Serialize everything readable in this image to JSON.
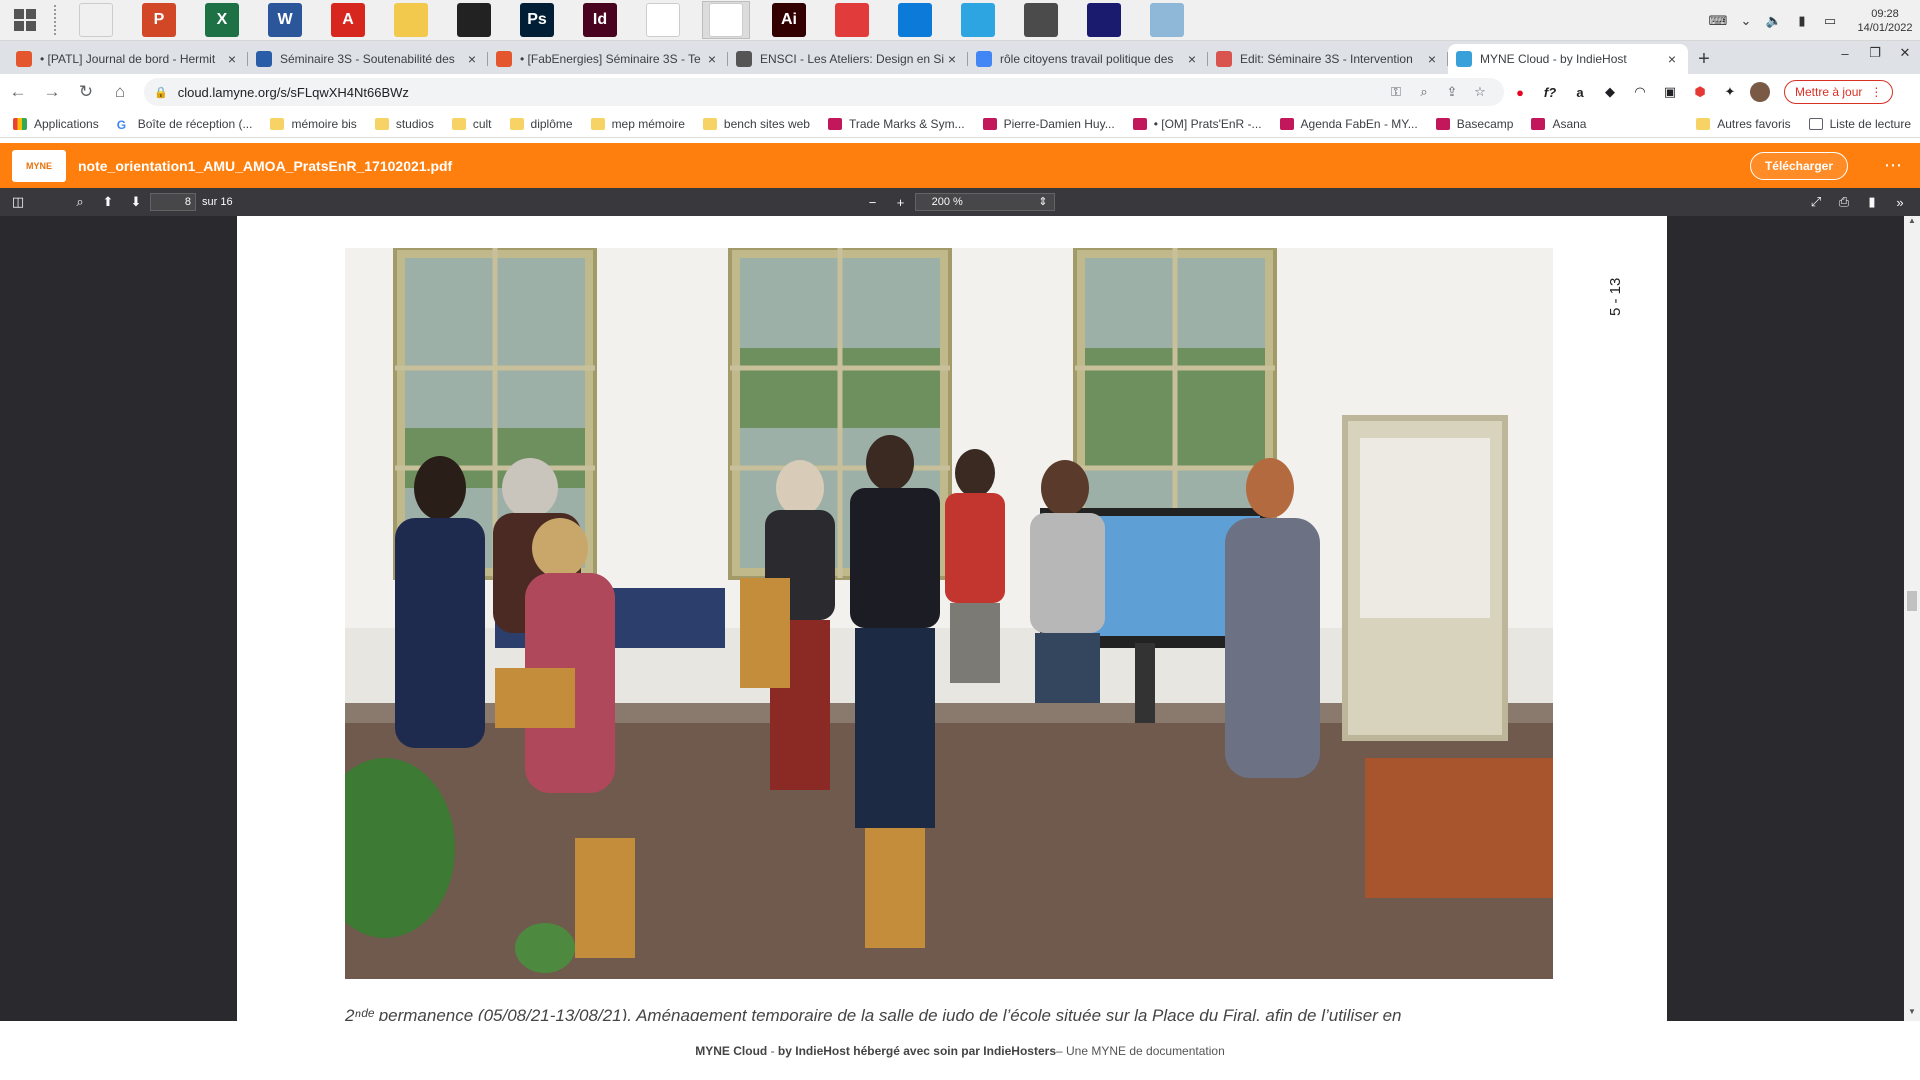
{
  "taskbar": {
    "apps": [
      {
        "icon": "file-explorer-icon",
        "label": "",
        "color": "#f0f0f0"
      },
      {
        "icon": "powerpoint-icon",
        "label": "P",
        "color": "#d24726"
      },
      {
        "icon": "excel-icon",
        "label": "X",
        "color": "#1e7145"
      },
      {
        "icon": "word-icon",
        "label": "W",
        "color": "#2b579a"
      },
      {
        "icon": "acrobat-icon",
        "label": "A",
        "color": "#d7261e"
      },
      {
        "icon": "folder-icon",
        "label": "",
        "color": "#f2c94c"
      },
      {
        "icon": "inkscape-icon",
        "label": "",
        "color": "#222222"
      },
      {
        "icon": "photoshop-icon",
        "label": "Ps",
        "color": "#001e36"
      },
      {
        "icon": "indesign-icon",
        "label": "Id",
        "color": "#49021f"
      },
      {
        "icon": "pdf-icon",
        "label": "",
        "color": "#ffffff"
      },
      {
        "icon": "chrome-icon",
        "label": "",
        "color": "#ffffff"
      },
      {
        "icon": "illustrator-icon",
        "label": "Ai",
        "color": "#330000"
      },
      {
        "icon": "chat-icon",
        "label": "",
        "color": "#e23b3b"
      },
      {
        "icon": "edge-icon",
        "label": "",
        "color": "#0c7ad8"
      },
      {
        "icon": "telegram-icon",
        "label": "",
        "color": "#2ca5e0"
      },
      {
        "icon": "sublime-icon",
        "label": "",
        "color": "#4b4b4b"
      },
      {
        "icon": "audacity-icon",
        "label": "",
        "color": "#1a1a6e"
      },
      {
        "icon": "notes-icon",
        "label": "",
        "color": "#8fb8d8"
      }
    ],
    "clock_time": "09:28",
    "clock_date": "14/01/2022"
  },
  "tabs": [
    {
      "title": "• [PATL] Journal de bord - Hermit",
      "fav_color": "#e4572e"
    },
    {
      "title": "Séminaire 3S - Soutenabilité des",
      "fav_color": "#2a5da8"
    },
    {
      "title": "• [FabEnergies] Séminaire 3S - Te",
      "fav_color": "#e4572e"
    },
    {
      "title": "ENSCI - Les Ateliers: Design en Si",
      "fav_color": "#555555"
    },
    {
      "title": "rôle citoyens travail politique des",
      "fav_color": "#4285f4"
    },
    {
      "title": "Edit: Séminaire 3S - Intervention",
      "fav_color": "#d9534f"
    },
    {
      "title": "MYNE Cloud - by IndieHost",
      "fav_color": "#3aa0d9"
    }
  ],
  "address": {
    "url": "cloud.lamyne.org/s/sFLqwXH4Nt66BWz",
    "update_label": "Mettre à jour"
  },
  "bookmarks": [
    {
      "label": "Applications",
      "type": "apps"
    },
    {
      "label": "Boîte de réception (...",
      "type": "google"
    },
    {
      "label": "mémoire bis",
      "type": "folder"
    },
    {
      "label": "studios",
      "type": "folder"
    },
    {
      "label": "cult",
      "type": "folder"
    },
    {
      "label": "diplôme",
      "type": "folder"
    },
    {
      "label": "mep mémoire",
      "type": "folder"
    },
    {
      "label": "bench sites web",
      "type": "folder"
    },
    {
      "label": "Trade Marks & Sym...",
      "type": "site"
    },
    {
      "label": "Pierre-Damien Huy...",
      "type": "site"
    },
    {
      "label": "• [OM] Prats'EnR -...",
      "type": "site"
    },
    {
      "label": "Agenda FabEn - MY...",
      "type": "site"
    },
    {
      "label": "Basecamp",
      "type": "site"
    },
    {
      "label": "Asana",
      "type": "site"
    }
  ],
  "bookmarks_right": [
    "Autres favoris",
    "Liste de lecture"
  ],
  "app": {
    "logo_text": "MYNE",
    "filename": "note_orientation1_AMU_AMOA_PratsEnR_17102021.pdf",
    "download_label": "Télécharger"
  },
  "pdf": {
    "page": "8",
    "page_count": "sur 16",
    "zoom": "200 %",
    "page_marker": "5 - 13",
    "caption": "2ⁿᵈᵉ permanence (05/08/21-13/08/21). Aménagement temporaire de la salle de judo de l’école située sur la Place du Firal, afin de l’utiliser en"
  },
  "footer": {
    "brand": "MYNE Cloud",
    "by": "by IndieHost hébergé avec soin par IndieHosters",
    "tail": " – Une MYNE de documentation"
  }
}
